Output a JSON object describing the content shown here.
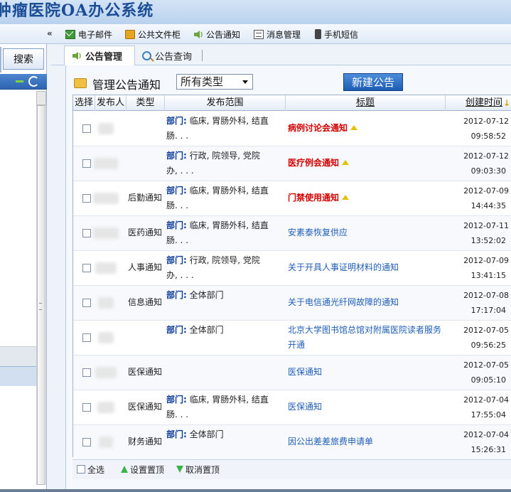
{
  "app_title": "肿瘤医院OA办公系统",
  "toolbar": {
    "collapse": "«",
    "items": [
      {
        "label": "电子邮件",
        "icon": "mail-icon"
      },
      {
        "label": "公共文件柜",
        "icon": "folder-icon"
      },
      {
        "label": "公告通知",
        "icon": "speaker-icon"
      },
      {
        "label": "消息管理",
        "icon": "message-icon"
      },
      {
        "label": "手机短信",
        "icon": "phone-icon"
      }
    ]
  },
  "left": {
    "search_label": "搜索"
  },
  "tabs": {
    "active": "公告管理",
    "inactive": "公告查询"
  },
  "header": {
    "title": "管理公告通知",
    "type_select": "所有类型",
    "new_button": "新建公告"
  },
  "columns": {
    "select": "选择",
    "publisher": "发布人",
    "type": "类型",
    "scope": "发布范围",
    "title": "标题",
    "created": "创建时间"
  },
  "scope_key": "部门:",
  "rows": [
    {
      "type": "",
      "scope1": "临床, 胃肠外科, 结直",
      "scope2": "肠. . .",
      "title": "病例讨论会通知",
      "title_style": "red",
      "top": true,
      "date": "2012-07-12",
      "time": "09:58:52"
    },
    {
      "type": "",
      "scope1": "行政, 院领导, 党院",
      "scope2": "办, . . .",
      "title": "医疗例会通知",
      "title_style": "red",
      "top": true,
      "date": "2012-07-12",
      "time": "09:03:30"
    },
    {
      "type": "后勤通知",
      "scope1": "临床, 胃肠外科, 结直",
      "scope2": "肠. . .",
      "title": "门禁使用通知",
      "title_style": "red",
      "top": true,
      "date": "2012-07-09",
      "time": "14:44:35"
    },
    {
      "type": "医药通知",
      "scope1": "临床, 胃肠外科, 结直",
      "scope2": "肠. . .",
      "title": "安素泰恢复供应",
      "title_style": "blue",
      "top": false,
      "date": "2012-07-11",
      "time": "13:52:02"
    },
    {
      "type": "人事通知",
      "scope1": "行政, 院领导, 党院",
      "scope2": "办, . . .",
      "title": "关于开具人事证明材料的通知",
      "title_style": "blue",
      "top": false,
      "date": "2012-07-09",
      "time": "13:41:15"
    },
    {
      "type": "信息通知",
      "scope1": "全体部门",
      "scope2": "",
      "title": "关于电信通光纤网故障的通知",
      "title_style": "blue",
      "top": false,
      "date": "2012-07-08",
      "time": "17:17:04"
    },
    {
      "type": "",
      "scope1": "全体部门",
      "scope2": "",
      "title": "北京大学图书馆总馆对附属医院读者服务",
      "title2": "开通",
      "title_style": "blue",
      "top": false,
      "date": "2012-07-05",
      "time": "09:56:25"
    },
    {
      "type": "医保通知",
      "scope1": "",
      "scope2": "",
      "title": "医保通知",
      "title_style": "blue",
      "top": false,
      "date": "2012-07-05",
      "time": "09:05:10",
      "noscope": true
    },
    {
      "type": "医保通知",
      "scope1": "临床, 胃肠外科, 结直",
      "scope2": "肠. . .",
      "title": "医保通知",
      "title_style": "blue",
      "top": false,
      "date": "2012-07-04",
      "time": "17:55:04"
    },
    {
      "type": "财务通知",
      "scope1": "全体部门",
      "scope2": "",
      "title": "因公出差差旅费申请单",
      "title_style": "blue",
      "top": false,
      "date": "2012-07-04",
      "time": "15:26:31"
    }
  ],
  "footer": {
    "select_all": "全选",
    "set_top": "设置置顶",
    "cancel_top": "取消置顶"
  }
}
